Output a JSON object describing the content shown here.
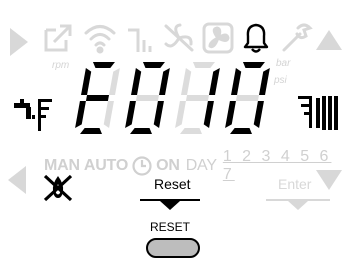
{
  "display": {
    "code": [
      "E",
      "0",
      "1",
      "0"
    ],
    "units": {
      "rpm": "rpm",
      "bar": "bar",
      "psi": "psi"
    },
    "modes": {
      "man": "MAN",
      "auto": "AUTO",
      "on": "ON",
      "day": "DAY"
    },
    "days": "1 2 3 4 5  6 7",
    "reset_label": "Reset",
    "enter_label": "Enter",
    "button_label": "RESET"
  },
  "icons": [
    "play-right-icon",
    "external-icon",
    "wifi-icon",
    "pump-icon",
    "fan-off-icon",
    "fan-icon",
    "bell-icon",
    "wrench-icon",
    "up-arrow-icon",
    "faucet-icon",
    "radiator-icon",
    "clock-icon",
    "flame-off-icon",
    "left-arrow-icon",
    "down-arrow-icon"
  ],
  "colors": {
    "active": "#000000",
    "inactive": "#dcdcdc",
    "button": "#bfbfbf"
  }
}
